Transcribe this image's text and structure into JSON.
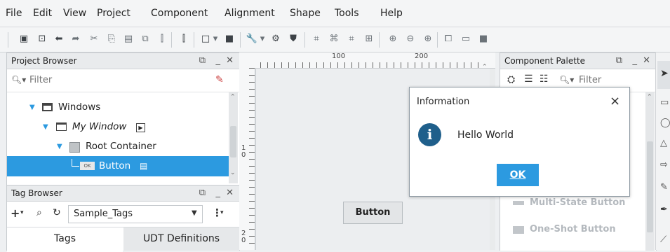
{
  "menu": [
    "File",
    "Edit",
    "View",
    "Project",
    "Component",
    "Alignment",
    "Shape",
    "Tools",
    "Help"
  ],
  "project_browser": {
    "title": "Project Browser",
    "filter_placeholder": "Filter",
    "tree": [
      {
        "label": "Windows"
      },
      {
        "label": "My Window"
      },
      {
        "label": "Root Container"
      },
      {
        "label": "Button",
        "badge": "OK"
      }
    ]
  },
  "tag_browser": {
    "title": "Tag Browser",
    "provider": "Sample_Tags",
    "tabs": [
      "Tags",
      "UDT Definitions"
    ]
  },
  "ruler": {
    "h_labels": [
      "100",
      "200"
    ],
    "v_labels": [
      "1\n0",
      "2\n0"
    ]
  },
  "canvas": {
    "button_label": "Button"
  },
  "component_palette": {
    "title": "Component Palette",
    "filter_placeholder": "Filter",
    "items": [
      "Multi-State Button",
      "One-Shot Button"
    ]
  },
  "dialog": {
    "title": "Information",
    "message": "Hello World",
    "ok_label": "OK",
    "close_glyph": "×"
  },
  "colors": {
    "selection": "#2c9ae0",
    "info_icon": "#1f5f8b",
    "ok_button": "#2c9ae0"
  }
}
